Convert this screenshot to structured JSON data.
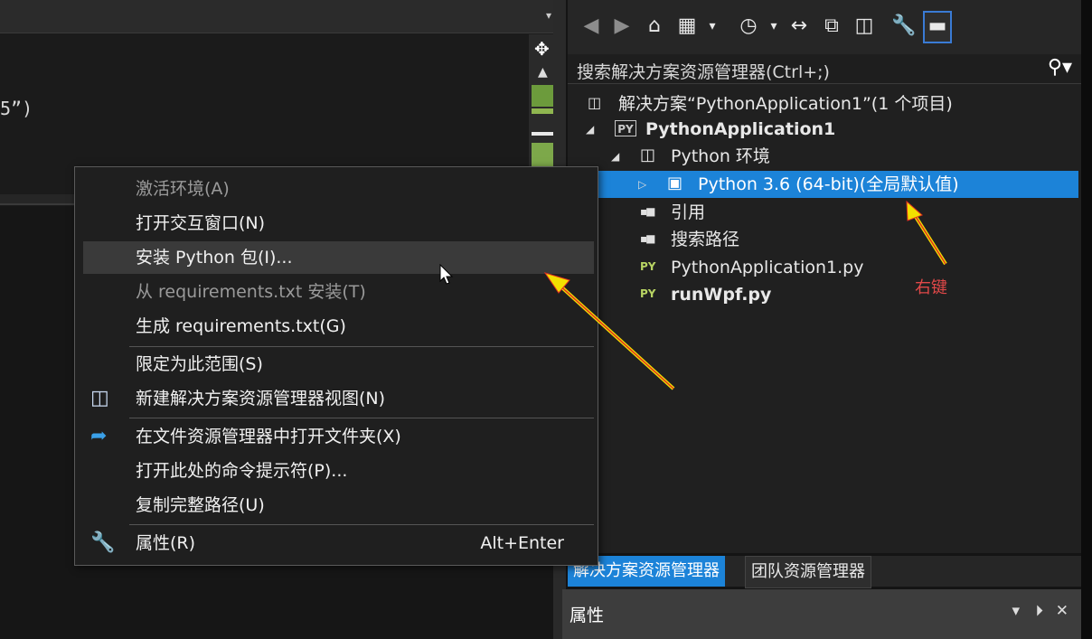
{
  "editor": {
    "code_fragment": "5”)"
  },
  "toolbar": {
    "back": "◀",
    "forward": "▶",
    "home": "⌂",
    "sync": "↔",
    "dropdown": "▾"
  },
  "search": {
    "placeholder": "搜索解决方案资源管理器(Ctrl+;)",
    "icon": "⌕"
  },
  "tree": {
    "solution": "解决方案“PythonApplication1”(1 个项目)",
    "project": "PythonApplication1",
    "py_badge": "PY",
    "env_folder": "Python 环境",
    "env_item": "Python 3.6 (64-bit)(全局默认值)",
    "references": "引用",
    "search_paths": "搜索路径",
    "file1": "PythonApplication1.py",
    "file2": "runWpf.py"
  },
  "annotation": {
    "right_click": "右键"
  },
  "panel_tabs": {
    "solution_explorer": "解决方案资源管理器",
    "team_explorer": "团队资源管理器"
  },
  "properties": {
    "title": "属性",
    "pin": "▾",
    "close": "✕"
  },
  "context_menu": {
    "activate_env": "激活环境(A)",
    "open_interactive": "打开交互窗口(N)",
    "install_package": "安装 Python 包(I)...",
    "install_from_requirements": "从 requirements.txt 安装(T)",
    "generate_requirements": "生成 requirements.txt(G)",
    "scope_to_this": "限定为此范围(S)",
    "new_solution_view": "新建解决方案资源管理器视图(N)",
    "open_folder": "在文件资源管理器中打开文件夹(X)",
    "open_cmd": "打开此处的命令提示符(P)...",
    "copy_path": "复制完整路径(U)",
    "properties": "属性(R)",
    "properties_shortcut": "Alt+Enter"
  },
  "colors": {
    "selection": "#1c83d8",
    "annotation_text": "#e04848",
    "arrow": "#f2e000"
  }
}
